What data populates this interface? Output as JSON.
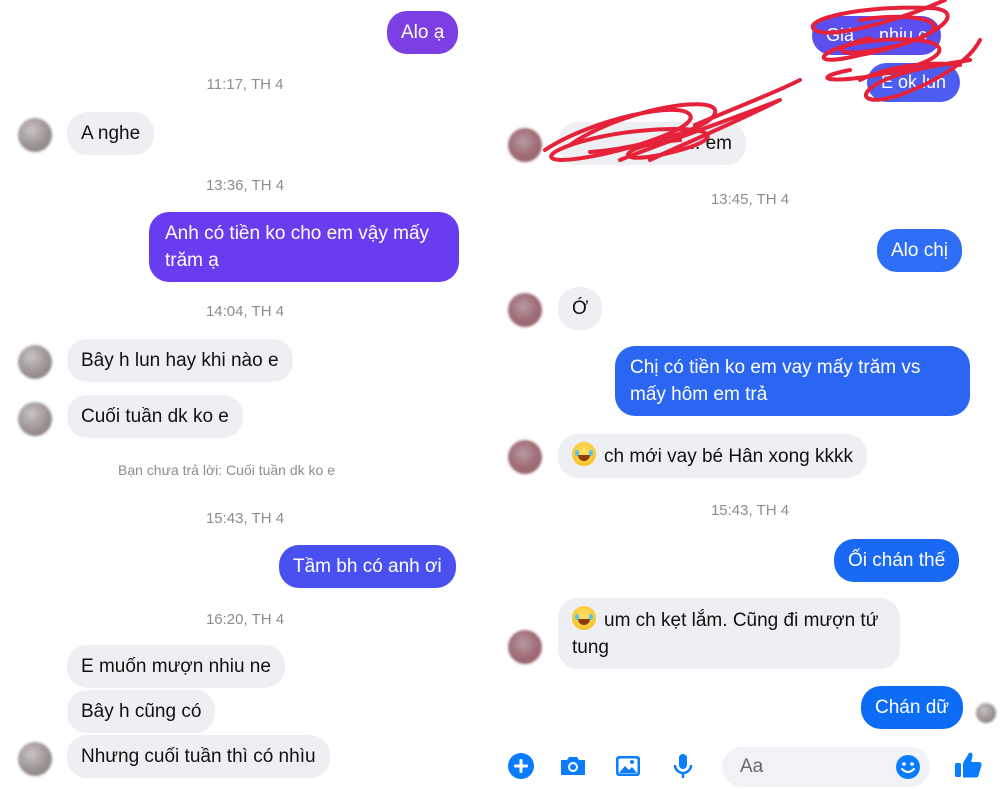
{
  "colors": {
    "purple": "#7b3fe4",
    "purple_blue": "#6a3cf0",
    "blue": "#0a68f5",
    "incoming_bg": "#eeeff2",
    "timestamp": "#8a8d91",
    "scribble_red": "#e5223a"
  },
  "left": {
    "messages": {
      "m1": "Alo ạ",
      "ts1": "11:17, TH 4",
      "m2": "A nghe",
      "ts2": "13:36, TH 4",
      "m3": "Anh có tiền ko cho em vậy mấy trăm ạ",
      "ts3": "14:04, TH 4",
      "m4": "Bây h lun hay khi nào e",
      "m5": "Cuối tuần dk ko e",
      "note": "Bạn chưa trả lời: Cuối tuần dk ko e",
      "ts4": "15:43, TH 4",
      "m6": "Tầm bh có anh ơi",
      "ts5": "16:20, TH 4",
      "m7": "E muốn mượn nhiu ne",
      "m8": "Bây h cũng có",
      "m9": "Nhưng cuối tuần thì có nhìu"
    }
  },
  "right": {
    "messages": {
      "r1": "Giá ... nhiu c",
      "r2": "E ok lun",
      "r3": "... em",
      "ts1": "13:45, TH 4",
      "r4": "Alo chị",
      "r5": "Ớ",
      "r6": "Chị có tiền ko em vay mấy trăm vs mấy hôm em trả",
      "r7": "ch mới vay bé Hân xong kkkk",
      "ts2": "15:43, TH 4",
      "r8": "Ối chán thế",
      "r9": "um ch kẹt lắm. Cũng đi mượn tứ tung",
      "r10": "Chán dữ"
    },
    "composer": {
      "placeholder": "Aa",
      "icons": [
        "plus-icon",
        "camera-icon",
        "image-icon",
        "microphone-icon",
        "smile-icon",
        "thumbs-up-icon"
      ]
    }
  }
}
